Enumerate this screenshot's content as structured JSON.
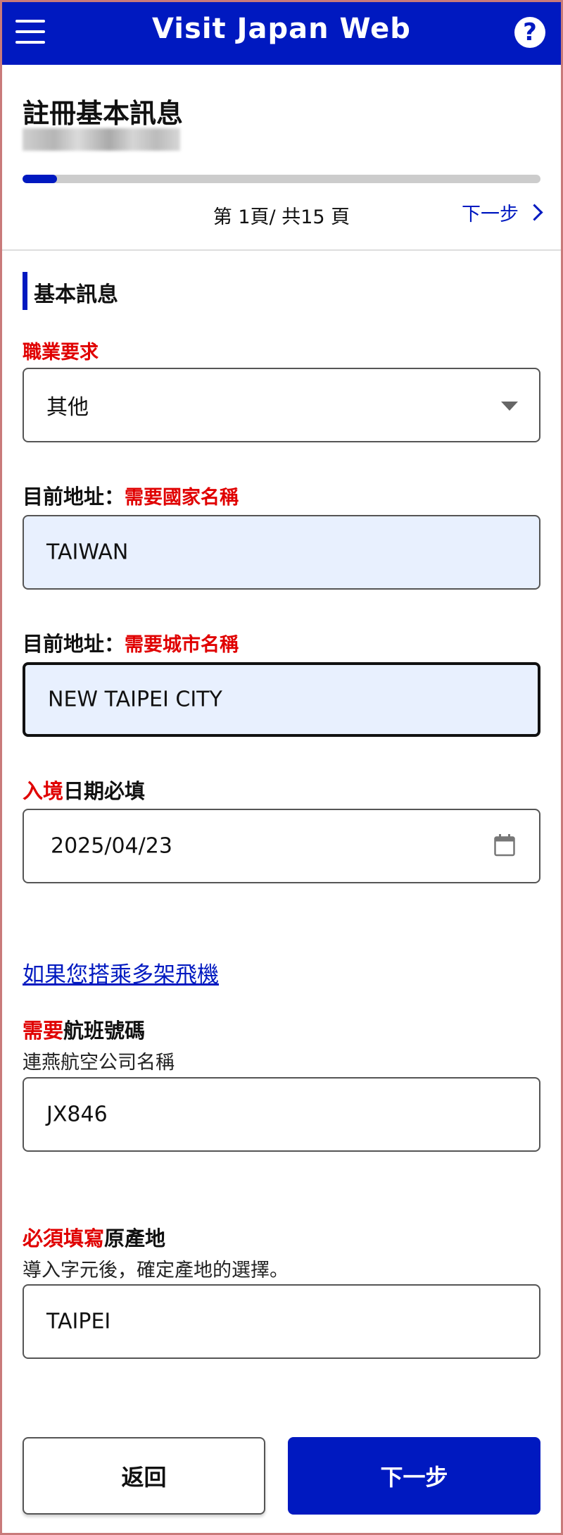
{
  "header": {
    "title": "Visit Japan Web",
    "help_icon": "?"
  },
  "page": {
    "title": "註冊基本訊息",
    "progress_fraction": 0.067,
    "page_count": "第 1頁/ 共15 頁",
    "next_link": "下一步"
  },
  "section": {
    "title": "基本訊息"
  },
  "occupation": {
    "label": "職業要求",
    "value": "其他"
  },
  "country": {
    "label": "目前地址：",
    "label_required": "需要國家名稱",
    "value": "TAIWAN"
  },
  "city": {
    "label": "目前地址：",
    "label_required": "需要城市名稱",
    "value": "NEW TAIPEI CITY"
  },
  "entry_date": {
    "label_red": "入境",
    "label": "日期必填",
    "value": "2025/04/23"
  },
  "multi_flight_link": "如果您搭乘多架飛機",
  "flight": {
    "label_red": "需要",
    "label": "航班號碼",
    "sub": "連燕航空公司名稱",
    "value": "JX846"
  },
  "origin": {
    "label_red": "必須填寫",
    "label": "原產地",
    "sub": "導入字元後，確定產地的選擇。",
    "value": "TAIPEI"
  },
  "buttons": {
    "back": "返回",
    "next": "下一步"
  },
  "colors": {
    "brand": "#0019c0",
    "required": "#e00000",
    "filled_bg": "#e8f0fe"
  }
}
